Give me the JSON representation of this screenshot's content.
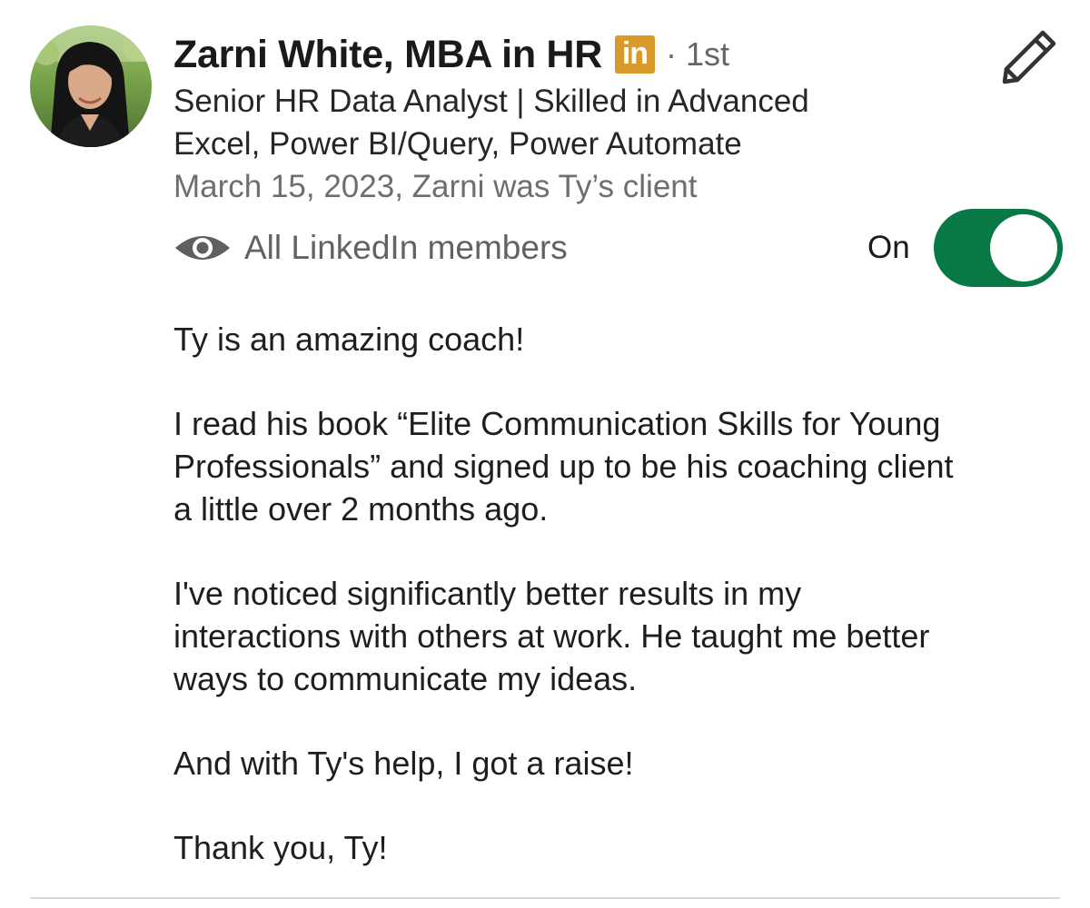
{
  "recommender": {
    "name": "Zarni White, MBA in HR",
    "badge_text": "in",
    "degree": "· 1st",
    "headline_lines": [
      "Senior HR Data Analyst | Skilled in Advanced",
      "Excel, Power BI/Query, Power Automate"
    ],
    "relationship": "March 15, 2023, Zarni was Ty’s client"
  },
  "visibility": {
    "icon": "eye-icon",
    "label": "All LinkedIn members",
    "toggle_label": "On",
    "toggle_on": true
  },
  "recommendation": {
    "paragraphs": [
      [
        "Ty is an amazing coach!"
      ],
      [
        "I read his book “Elite Communication Skills for Young",
        "Professionals” and signed up to be his coaching client",
        "a little over 2 months ago."
      ],
      [
        "I've noticed significantly better results in my",
        "interactions with others at work. He taught me better",
        "ways to communicate my ideas."
      ],
      [
        "And with Ty's help, I got a raise!"
      ],
      [
        "Thank you, Ty!"
      ]
    ]
  },
  "colors": {
    "toggle_on": "#087847",
    "linkedin_badge": "#d79a2b"
  }
}
